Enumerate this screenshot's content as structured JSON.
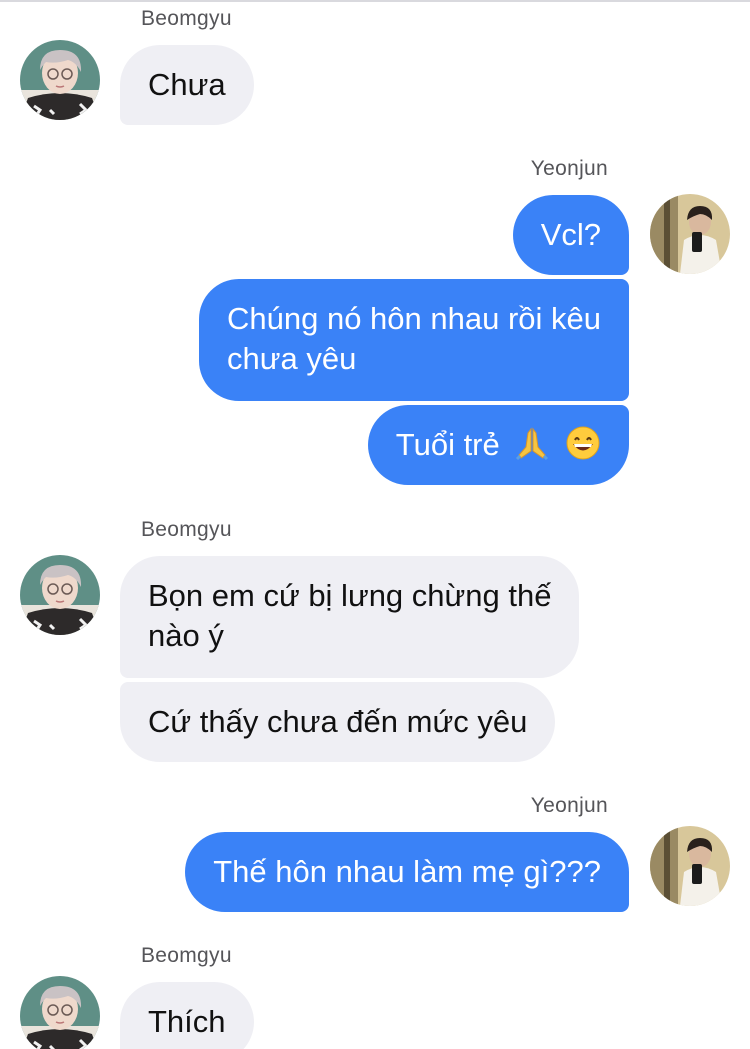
{
  "chat": {
    "messages": [
      {
        "sender": "Beomgyu",
        "text": "Chưa"
      },
      {
        "sender": "Yeonjun",
        "text": "Vcl?"
      },
      {
        "text_line1": "Chúng nó hôn nhau rồi kêu",
        "text_line2": "chưa yêu"
      },
      {
        "text": "Tuổi trẻ",
        "emojis": [
          "folded-hands",
          "grinning-face"
        ]
      },
      {
        "sender": "Beomgyu",
        "text_line1": "Bọn em cứ bị lưng chừng thế",
        "text_line2": "nào ý"
      },
      {
        "text": "Cứ thấy chưa đến mức yêu"
      },
      {
        "sender": "Yeonjun",
        "text": "Thế hôn nhau làm mẹ gì???"
      },
      {
        "sender": "Beomgyu",
        "text": "Thích"
      }
    ]
  },
  "colors": {
    "outgoing_bubble": "#3a82f7",
    "incoming_bubble": "#efeff4",
    "sender_name": "#555559"
  },
  "icons": {
    "avatar_beomgyu": "beomgyu-avatar-photo",
    "avatar_yeonjun": "yeonjun-avatar-photo"
  }
}
